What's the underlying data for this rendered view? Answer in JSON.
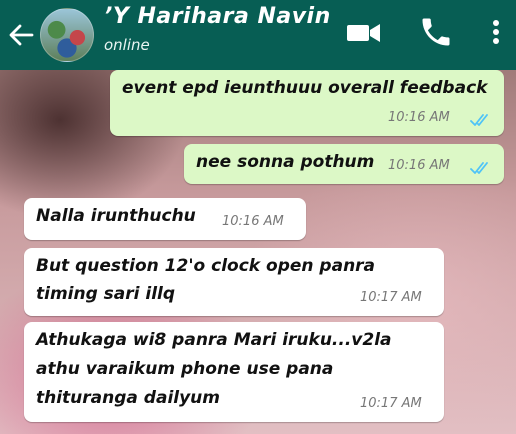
{
  "header": {
    "contact_name": "’Y Harihara Navin",
    "status": "online"
  },
  "messages": [
    {
      "direction": "outgoing",
      "lines": [
        "event epd ieunthuuu overall feedback"
      ],
      "time": "10:16 AM",
      "read": true
    },
    {
      "direction": "outgoing",
      "lines": [
        "nee sonna pothum"
      ],
      "time": "10:16 AM",
      "read": true
    },
    {
      "direction": "incoming",
      "lines": [
        "Nalla irunthuchu"
      ],
      "time": "10:16 AM"
    },
    {
      "direction": "incoming",
      "lines": [
        "But question 12'o clock open panra",
        "timing sari illq"
      ],
      "time": "10:17 AM"
    },
    {
      "direction": "incoming",
      "lines": [
        "Athukaga wi8 panra Mari iruku...v2la",
        "athu varaikum phone use pana",
        "thituranga dailyum"
      ],
      "time": "10:17 AM"
    }
  ],
  "colors": {
    "header": "#075e54",
    "outgoing_bubble": "#dcf8c6",
    "incoming_bubble": "#ffffff",
    "read_ticks": "#4fc3f7"
  },
  "icons": [
    "back-arrow-icon",
    "avatar",
    "video-call-icon",
    "phone-icon",
    "more-vert-icon",
    "double-check-icon"
  ]
}
